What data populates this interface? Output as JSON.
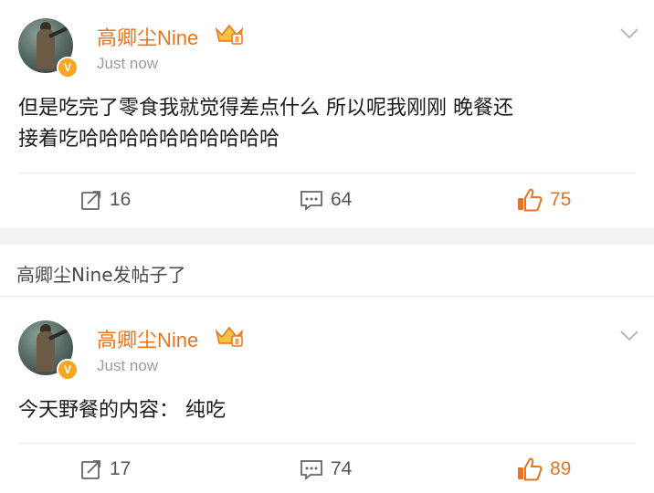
{
  "posts": [
    {
      "username": "高卿尘Nine",
      "time": "Just now",
      "content_lines": [
        "但是吃完了零食我就觉得差点什么 所以呢我刚刚 晚餐还",
        "接着吃哈哈哈哈哈哈哈哈哈哈"
      ],
      "repost_count": "16",
      "comment_count": "64",
      "like_count": "75"
    },
    {
      "username": "高卿尘Nine",
      "time": "Just now",
      "content_lines": [
        "今天野餐的内容： 纯吃"
      ],
      "repost_count": "17",
      "comment_count": "74",
      "like_count": "89"
    }
  ],
  "notice": "高卿尘Nine发帖子了",
  "verified_badge": "V",
  "colors": {
    "accent": "#e8741e",
    "badge": "#f5a623",
    "muted": "#9b9b9b",
    "separator": "#f2f2f2"
  },
  "icons": {
    "repost": "repost-icon",
    "comment": "comment-icon",
    "like": "thumbs-up-icon",
    "more": "chevron-down-icon",
    "vip": "crown-icon"
  }
}
